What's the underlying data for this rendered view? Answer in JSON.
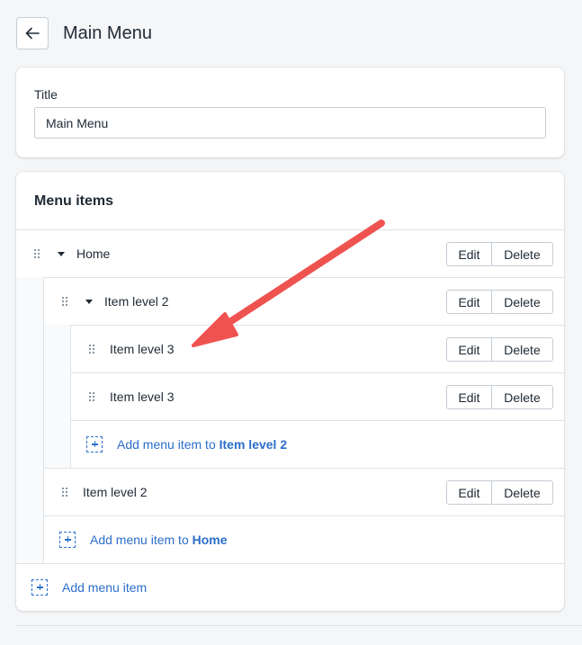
{
  "header": {
    "title": "Main Menu",
    "back_icon": "arrow-left-icon"
  },
  "title_section": {
    "label": "Title",
    "value": "Main Menu"
  },
  "menu_section": {
    "heading": "Menu items",
    "items": [
      {
        "label": "Home",
        "level": 1,
        "expanded": true
      },
      {
        "label": "Item level 2",
        "level": 2,
        "expanded": true
      },
      {
        "label": "Item level 3",
        "level": 3
      },
      {
        "label": "Item level 3",
        "level": 3
      },
      {
        "label": "Item level 2",
        "level": 2
      }
    ],
    "edit_label": "Edit",
    "delete_label": "Delete",
    "add_to_level2": {
      "prefix": "Add menu item to ",
      "target": "Item level 2"
    },
    "add_to_home": {
      "prefix": "Add menu item to ",
      "target": "Home"
    },
    "add_item": "Add menu item"
  },
  "colors": {
    "accent": "#2c6ecb",
    "annotation_arrow": "#ef5350",
    "background": "#f4f6f8"
  }
}
